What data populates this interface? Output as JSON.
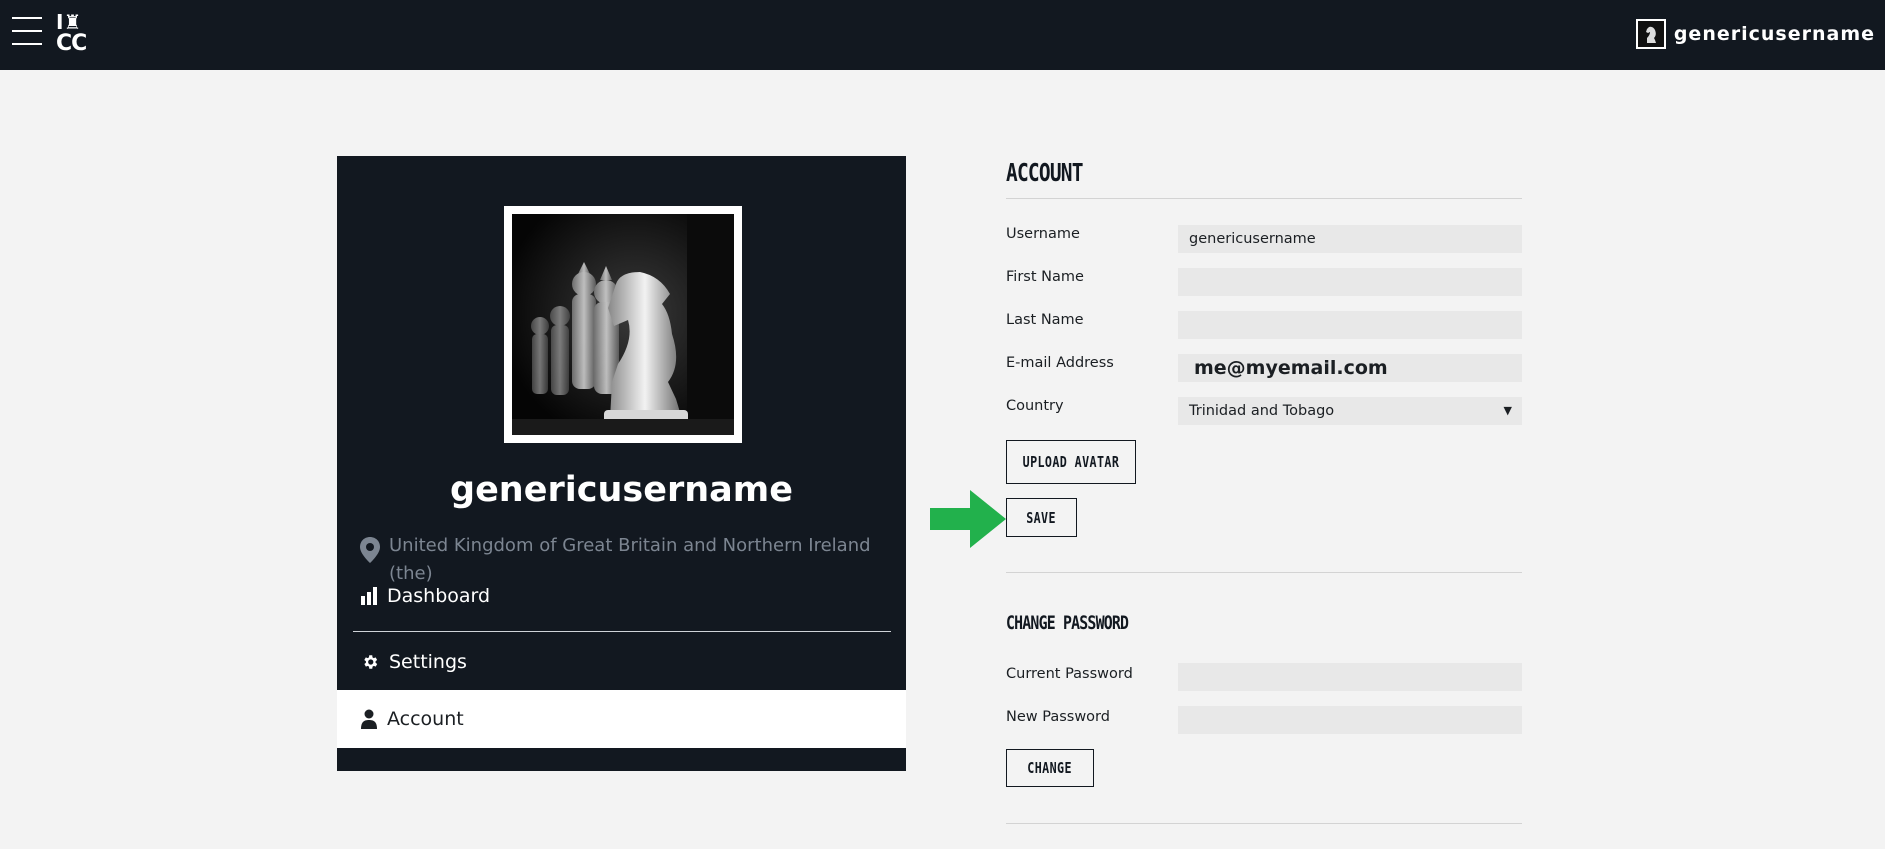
{
  "topbar": {
    "logo_row1": "I♜",
    "logo_row2": "CC",
    "username": "genericusername"
  },
  "profile": {
    "name": "genericusername",
    "location": "United Kingdom of Great Britain and Northern Ireland (the)",
    "nav": [
      {
        "label": "Dashboard",
        "icon": "bar-chart-icon"
      },
      {
        "label": "Settings",
        "icon": "gear-icon"
      },
      {
        "label": "Account",
        "icon": "user-icon",
        "active": true
      }
    ]
  },
  "account": {
    "title": "ACCOUNT",
    "fields": {
      "username": {
        "label": "Username",
        "value": "genericusername"
      },
      "first_name": {
        "label": "First Name",
        "value": ""
      },
      "last_name": {
        "label": "Last Name",
        "value": ""
      },
      "email": {
        "label": "E-mail Address",
        "value": "me@myemail.com"
      },
      "country": {
        "label": "Country",
        "value": "Trinidad and Tobago"
      }
    },
    "upload_label": "UPLOAD AVATAR",
    "save_label": "SAVE"
  },
  "password": {
    "title": "CHANGE PASSWORD",
    "current_label": "Current Password",
    "new_label": "New Password",
    "change_label": "CHANGE"
  },
  "colors": {
    "dark": "#121820",
    "page_bg": "#f3f3f3",
    "input_bg": "#e8e8e8",
    "arrow": "#22b14c"
  }
}
